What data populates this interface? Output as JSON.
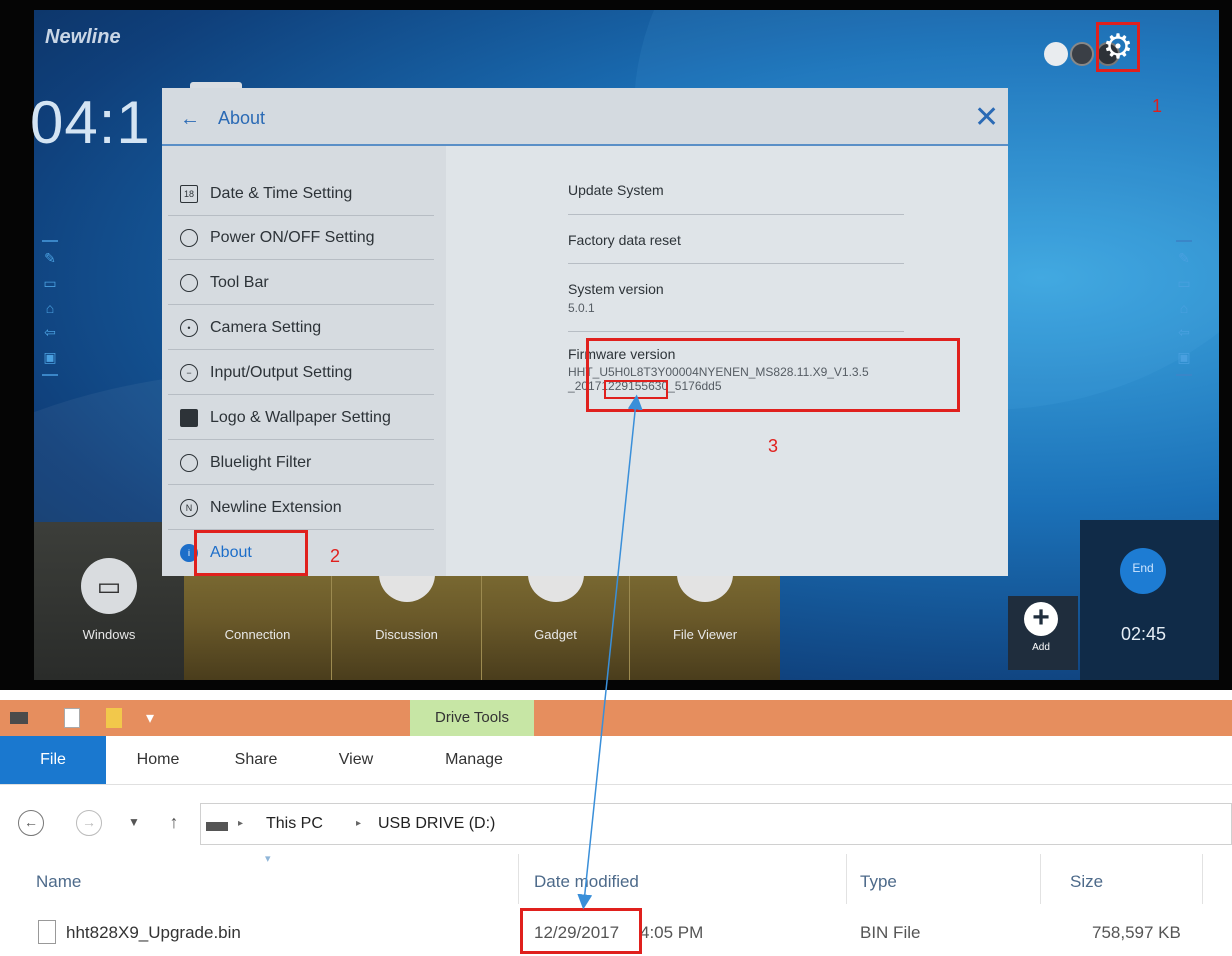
{
  "tv": {
    "brand": "Newline",
    "clock": "04:1",
    "markers": {
      "gear": "1",
      "about": "2",
      "firmware": "3"
    },
    "dialog": {
      "title": "About",
      "menu": [
        {
          "label": "Date & Time Setting",
          "icon": "calendar-icon"
        },
        {
          "label": "Power ON/OFF Setting",
          "icon": "power-timer-icon"
        },
        {
          "label": "Tool Bar",
          "icon": "toolbar-icon"
        },
        {
          "label": "Camera Setting",
          "icon": "camera-icon"
        },
        {
          "label": "Input/Output Setting",
          "icon": "input-output-icon"
        },
        {
          "label": "Logo & Wallpaper Setting",
          "icon": "image-icon"
        },
        {
          "label": "Bluelight Filter",
          "icon": "eye-icon"
        },
        {
          "label": "Newline Extension",
          "icon": "newline-icon"
        },
        {
          "label": "About",
          "icon": "info-icon"
        }
      ],
      "right": {
        "update": "Update System",
        "factory": "Factory data reset",
        "system_version_label": "System version",
        "system_version_value": "5.0.1",
        "firmware_label": "Firmware version",
        "firmware_line1": "HHT_U5H0L8T3Y00004NYENEN_MS828.11.X9_V1.3.5",
        "firmware_line2_pre": "_",
        "firmware_date": "20171229",
        "firmware_line2_post": "155630_5176dd5"
      }
    },
    "dock": {
      "windows": "Windows",
      "connection": "Connection",
      "discussion": "Discussion",
      "gadget": "Gadget",
      "file_viewer": "File Viewer",
      "add": "Add",
      "end": "End",
      "timer": "02:45"
    }
  },
  "explorer": {
    "ribbon_context": "Drive Tools",
    "tabs": {
      "file": "File",
      "home": "Home",
      "share": "Share",
      "view": "View",
      "manage": "Manage"
    },
    "address": {
      "this_pc": "This PC",
      "drive": "USB DRIVE (D:)"
    },
    "columns": {
      "name": "Name",
      "date": "Date modified",
      "type": "Type",
      "size": "Size"
    },
    "row": {
      "name": "hht828X9_Upgrade.bin",
      "date": "12/29/2017",
      "time": "4:05 PM",
      "type": "BIN File",
      "size": "758,597 KB"
    }
  },
  "colors": {
    "highlight": "#e0201d",
    "arrow": "#3a8fd9",
    "file_tab": "#1a78cf"
  }
}
